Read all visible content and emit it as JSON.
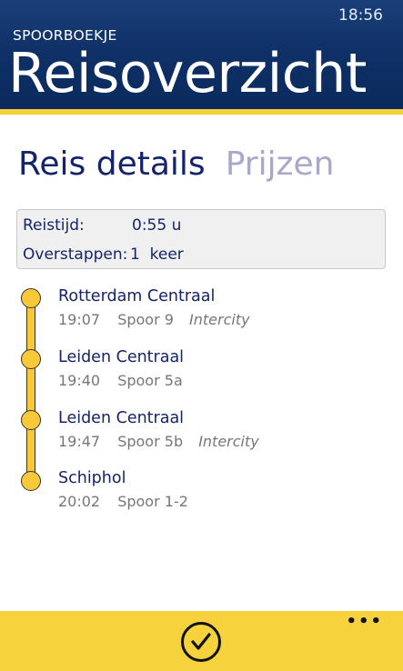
{
  "status": {
    "time": "18:56"
  },
  "header": {
    "app_name": "SPOORBOEKJE",
    "title": "Reisoverzicht"
  },
  "pivot": {
    "tabs": [
      {
        "label": "Reis details"
      },
      {
        "label": "Prijzen"
      }
    ]
  },
  "summary": {
    "travel_time_label": "Reistijd:",
    "travel_time_value": "0:55 u",
    "transfers_label": "Overstappen:",
    "transfers_value": "1  keer"
  },
  "stops": [
    {
      "station": "Rotterdam Centraal",
      "time": "19:07",
      "platform": "Spoor 9",
      "type": "Intercity"
    },
    {
      "station": "Leiden Centraal",
      "time": "19:40",
      "platform": "Spoor 5a",
      "type": ""
    },
    {
      "station": "Leiden Centraal",
      "time": "19:47",
      "platform": "Spoor 5b",
      "type": "Intercity"
    },
    {
      "station": "Schiphol",
      "time": "20:02",
      "platform": "Spoor 1-2",
      "type": ""
    }
  ],
  "appbar": {
    "confirm_icon": "check-circle-icon",
    "more_label": "•••"
  },
  "colors": {
    "header": "#0f3168",
    "accent": "#f6cf3a",
    "text": "#15246a"
  }
}
